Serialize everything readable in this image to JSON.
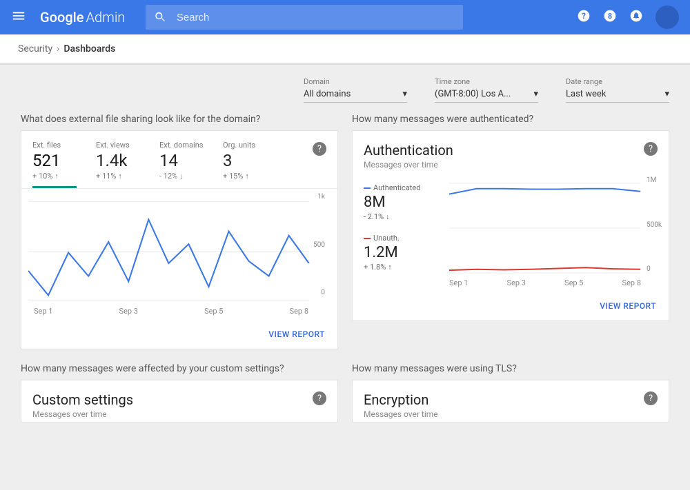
{
  "header": {
    "logo_main": "Google",
    "logo_sub": "Admin",
    "search_placeholder": "Search"
  },
  "breadcrumb": {
    "parent": "Security",
    "current": "Dashboards"
  },
  "filters": {
    "domain": {
      "label": "Domain",
      "value": "All domains"
    },
    "timezone": {
      "label": "Time zone",
      "value": "(GMT-8:00) Los A..."
    },
    "daterange": {
      "label": "Date range",
      "value": "Last week"
    }
  },
  "cards": {
    "sharing": {
      "question": "What does external file sharing look like for the domain?",
      "stats": [
        {
          "label": "Ext. files",
          "value": "521",
          "delta": "+ 10%",
          "dir": "up"
        },
        {
          "label": "Ext. views",
          "value": "1.4k",
          "delta": "+ 11%",
          "dir": "up"
        },
        {
          "label": "Ext. domains",
          "value": "14",
          "delta": "- 12%",
          "dir": "down"
        },
        {
          "label": "Org. units",
          "value": "3",
          "delta": "+ 15%",
          "dir": "up"
        }
      ],
      "footer": "VIEW REPORT"
    },
    "auth": {
      "question": "How many messages were authenticated?",
      "title": "Authentication",
      "subtitle": "Messages over time",
      "series": [
        {
          "name": "Authenticated",
          "value": "8M",
          "delta": "- 2.1%",
          "dir": "down",
          "color": "#3b78e7"
        },
        {
          "name": "Unauth.",
          "value": "1.2M",
          "delta": "+ 1.8%",
          "dir": "up",
          "color": "#d83a2f"
        }
      ],
      "footer": "VIEW REPORT"
    },
    "custom": {
      "question": "How many messages were affected by your custom settings?",
      "title": "Custom settings",
      "subtitle": "Messages over time"
    },
    "encryption": {
      "question": "How many messages were using TLS?",
      "title": "Encryption",
      "subtitle": "Messages over time"
    }
  },
  "chart_data": [
    {
      "id": "ext_files_line",
      "type": "line",
      "xlabel": "",
      "ylabel": "",
      "ylim": [
        0,
        1000
      ],
      "yticks": [
        "1k",
        "500",
        "0"
      ],
      "categories": [
        "Sep 1",
        "Sep 3",
        "Sep 5",
        "Sep 8"
      ],
      "x": [
        1,
        2,
        3,
        4,
        5,
        6,
        7,
        8,
        9,
        10,
        11,
        12,
        13,
        14,
        15
      ],
      "series": [
        {
          "name": "Ext. files",
          "color": "#3b78e7",
          "values": [
            350,
            120,
            520,
            300,
            620,
            250,
            830,
            420,
            600,
            200,
            720,
            440,
            300,
            680,
            420
          ]
        }
      ]
    },
    {
      "id": "authentication_line",
      "type": "line",
      "xlabel": "",
      "ylabel": "",
      "ylim": [
        0,
        1000000
      ],
      "yticks": [
        "1M",
        "500k",
        "0"
      ],
      "categories": [
        "Sep 1",
        "Sep 3",
        "Sep 5",
        "Sep 8"
      ],
      "x": [
        1,
        2,
        3,
        4,
        5,
        6,
        7,
        8
      ],
      "series": [
        {
          "name": "Authenticated",
          "color": "#3b78e7",
          "values": [
            880000,
            940000,
            940000,
            935000,
            935000,
            940000,
            940000,
            910000
          ]
        },
        {
          "name": "Unauth.",
          "color": "#d83a2f",
          "values": [
            30000,
            40000,
            35000,
            40000,
            50000,
            60000,
            45000,
            40000
          ]
        }
      ]
    }
  ]
}
